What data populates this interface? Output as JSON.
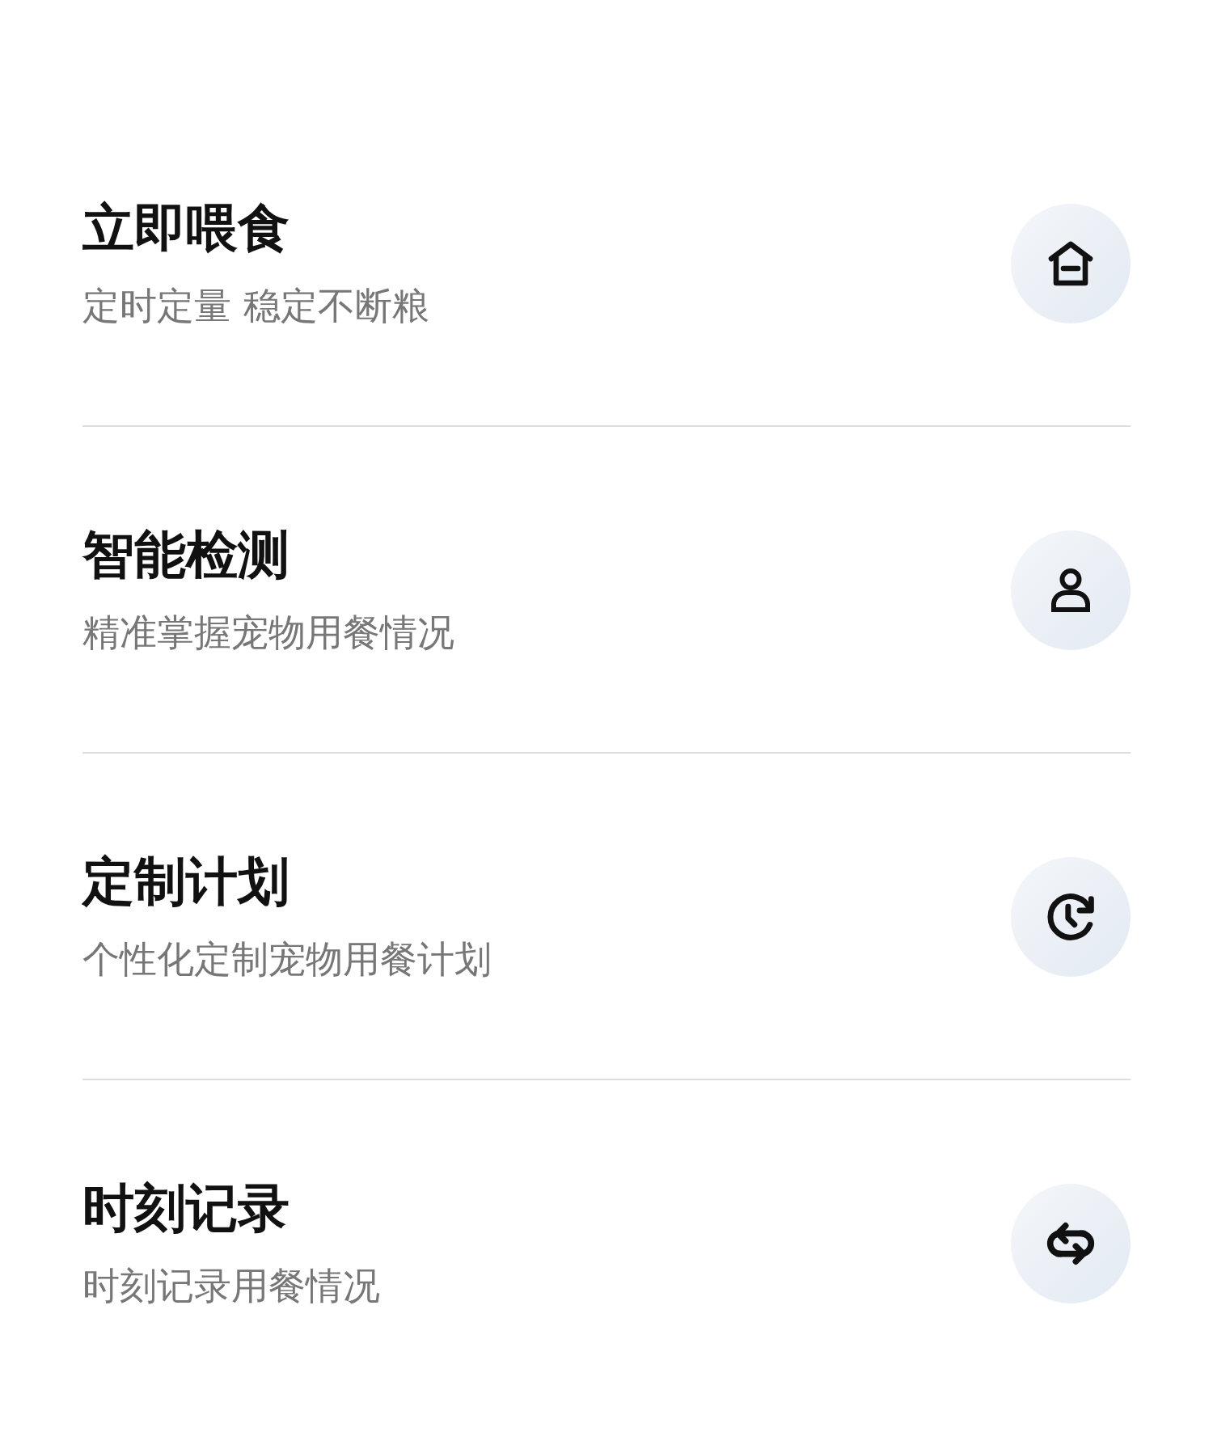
{
  "features": [
    {
      "title": "立即喂食",
      "subtitle": "定时定量 稳定不断粮",
      "kind": "home"
    },
    {
      "title": "智能检测",
      "subtitle": "精准掌握宠物用餐情况",
      "kind": "person"
    },
    {
      "title": "定制计划",
      "subtitle": "个性化定制宠物用餐计划",
      "kind": "clock"
    },
    {
      "title": "时刻记录",
      "subtitle": "时刻记录用餐情况",
      "kind": "repeat"
    }
  ]
}
